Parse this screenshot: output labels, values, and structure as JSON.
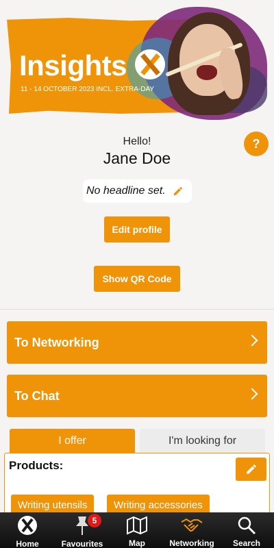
{
  "banner": {
    "logo_text": "Insights",
    "date_text": "11 - 14 OCTOBER 2023 INCL. EXTRA-DAY"
  },
  "help": {
    "label": "?"
  },
  "profile": {
    "greeting": "Hello!",
    "name": "Jane Doe",
    "headline": "No headline set.",
    "edit_label": "Edit profile",
    "qr_label": "Show QR Code"
  },
  "cards": {
    "networking": "To Networking",
    "chat": "To Chat"
  },
  "tabs": {
    "offer": "I offer",
    "looking": "I'm looking for"
  },
  "panel": {
    "title": "Products:",
    "chips": [
      "Writing utensils",
      "Writing accessories"
    ]
  },
  "bottom_nav": {
    "items": [
      {
        "label": "Home",
        "icon": "logo-x-icon"
      },
      {
        "label": "Favourites",
        "icon": "pin-icon",
        "badge": "5"
      },
      {
        "label": "Map",
        "icon": "map-icon"
      },
      {
        "label": "Networking",
        "icon": "handshake-icon",
        "active": true
      },
      {
        "label": "Search",
        "icon": "search-icon"
      }
    ]
  },
  "colors": {
    "accent": "#ef9409",
    "background": "#f6f4f2",
    "nav_background": "#1a1a1a",
    "badge": "#e01818"
  }
}
